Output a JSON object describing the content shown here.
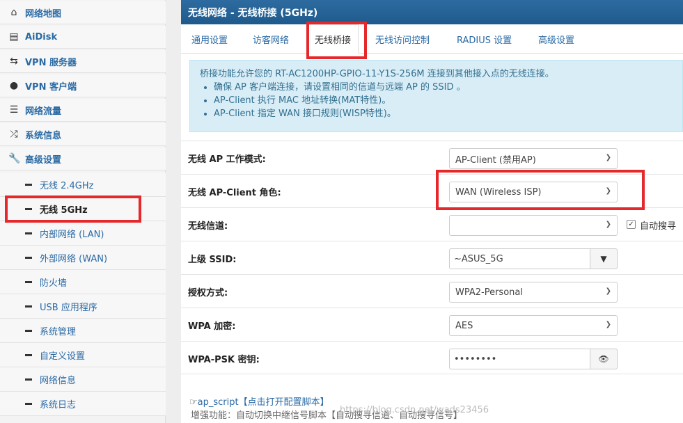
{
  "sidebar": {
    "items": [
      {
        "label": "网络地图",
        "icon": "home-icon"
      },
      {
        "label": "AiDisk",
        "icon": "disk-icon"
      },
      {
        "label": "VPN 服务器",
        "icon": "vpn-server-icon"
      },
      {
        "label": "VPN 客户端",
        "icon": "globe-icon"
      },
      {
        "label": "网络流量",
        "icon": "traffic-icon"
      },
      {
        "label": "系统信息",
        "icon": "shuffle-icon"
      },
      {
        "label": "高级设置",
        "icon": "wrench-icon"
      }
    ],
    "subitems": [
      {
        "label": "无线 2.4GHz"
      },
      {
        "label": "无线 5GHz"
      },
      {
        "label": "内部网络 (LAN)"
      },
      {
        "label": "外部网络 (WAN)"
      },
      {
        "label": "防火墙"
      },
      {
        "label": "USB 应用程序"
      },
      {
        "label": "系统管理"
      },
      {
        "label": "自定义设置"
      },
      {
        "label": "网络信息"
      },
      {
        "label": "系统日志"
      }
    ]
  },
  "header": {
    "title": "无线网络 - 无线桥接 (5GHz)"
  },
  "tabs": [
    {
      "label": "通用设置"
    },
    {
      "label": "访客网络"
    },
    {
      "label": "无线桥接"
    },
    {
      "label": "无线访问控制"
    },
    {
      "label": "RADIUS 设置"
    },
    {
      "label": "高级设置"
    }
  ],
  "info": {
    "intro": "桥接功能允许您的 RT-AC1200HP-GPIO-11-Y1S-256M 连接到其他接入点的无线连接。",
    "bullets": [
      "确保 AP 客户端连接，请设置相同的信道与远端 AP 的 SSID 。",
      "AP-Client 执行 MAC 地址转换(MAT特性)。",
      "AP-Client 指定 WAN 接口规则(WISP特性)。"
    ]
  },
  "form": {
    "ap_mode": {
      "label": "无线 AP 工作模式:",
      "value": "AP-Client (禁用AP)"
    },
    "client_role": {
      "label": "无线 AP-Client 角色:",
      "value": "WAN (Wireless ISP)"
    },
    "channel": {
      "label": "无线信道:",
      "value": "",
      "auto_label": "自动搜寻",
      "auto_checked": true
    },
    "ssid": {
      "label": "上级 SSID:",
      "value": "~ASUS_5G"
    },
    "auth": {
      "label": "授权方式:",
      "value": "WPA2-Personal"
    },
    "wpa": {
      "label": "WPA 加密:",
      "value": "AES"
    },
    "psk": {
      "label": "WPA-PSK 密钥:",
      "value": "••••••••"
    }
  },
  "footer": {
    "script_link": "ap_script",
    "script_hint": "【点击打开配置脚本】",
    "desc": "增强功能：自动切换中继信号脚本【自动搜寻信道、自动搜寻信号】"
  },
  "watermark": "https://blog.csdn.net/wads23456",
  "colors": {
    "accent": "#2a6aa5",
    "title_bar": "#1f5a8c",
    "highlight_box": "#e5282b",
    "info_bg": "#d9edf7"
  }
}
